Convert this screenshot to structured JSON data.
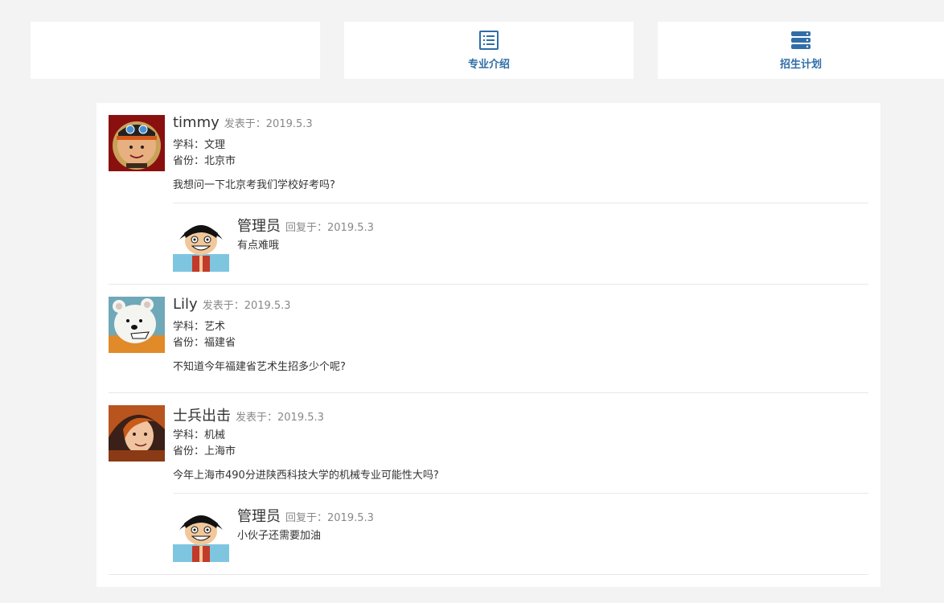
{
  "nav": {
    "items": [
      {
        "label": "",
        "icon": ""
      },
      {
        "label": "专业介绍",
        "icon": "list-icon"
      },
      {
        "label": "招生计划",
        "icon": "server-icon"
      }
    ]
  },
  "colors": {
    "accent": "#2f6da8",
    "background": "#f3f3f3"
  },
  "posts": [
    {
      "name": "timmy",
      "posted_label": "发表于：2019.5.3",
      "subject": "学科：文理",
      "province": "省份：北京市",
      "question": "我想问一下北京考我们学校好考吗?",
      "reply": {
        "name": "管理员",
        "replied_label": "回复于：2019.5.3",
        "text": "有点难哦"
      }
    },
    {
      "name": "Lily",
      "posted_label": "发表于：2019.5.3",
      "subject": "学科：艺术",
      "province": "省份：福建省",
      "question": "不知道今年福建省艺术生招多少个呢?"
    },
    {
      "name": "士兵出击",
      "posted_label": "发表于：2019.5.3",
      "subject": "学科：机械",
      "province": "省份：上海市",
      "question": "今年上海市490分进陕西科技大学的机械专业可能性大吗?",
      "reply": {
        "name": "管理员",
        "replied_label": "回复于：2019.5.3",
        "text": "小伙子还需要加油"
      }
    }
  ]
}
